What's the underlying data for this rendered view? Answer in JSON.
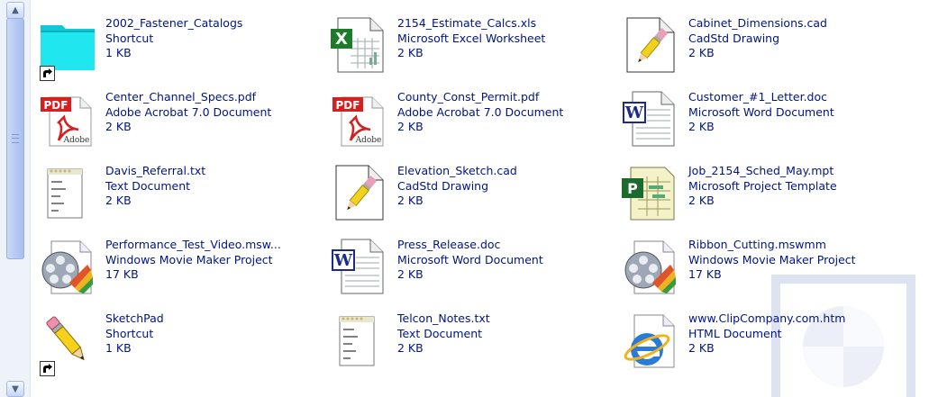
{
  "files": [
    {
      "name": "2002_Fastener_Catalogs",
      "type": "Shortcut",
      "size": "1 KB",
      "icon": "folder-shortcut-icon"
    },
    {
      "name": "2154_Estimate_Calcs.xls",
      "type": "Microsoft Excel Worksheet",
      "size": "2 KB",
      "icon": "excel-icon"
    },
    {
      "name": "Cabinet_Dimensions.cad",
      "type": "CadStd Drawing",
      "size": "2 KB",
      "icon": "cad-pencil-icon"
    },
    {
      "name": "Center_Channel_Specs.pdf",
      "type": "Adobe Acrobat 7.0 Document",
      "size": "2 KB",
      "icon": "pdf-icon"
    },
    {
      "name": "County_Const_Permit.pdf",
      "type": "Adobe Acrobat 7.0 Document",
      "size": "2 KB",
      "icon": "pdf-icon"
    },
    {
      "name": "Customer_#1_Letter.doc",
      "type": "Microsoft Word Document",
      "size": "2 KB",
      "icon": "word-icon"
    },
    {
      "name": "Davis_Referral.txt",
      "type": "Text Document",
      "size": "2 KB",
      "icon": "text-document-icon"
    },
    {
      "name": "Elevation_Sketch.cad",
      "type": "CadStd Drawing",
      "size": "2 KB",
      "icon": "cad-pencil-icon"
    },
    {
      "name": "Job_2154_Sched_May.mpt",
      "type": "Microsoft Project Template",
      "size": "2 KB",
      "icon": "project-icon"
    },
    {
      "name": "Performance_Test_Video.msw...",
      "type": "Windows Movie Maker Project",
      "size": "17 KB",
      "icon": "movie-maker-icon"
    },
    {
      "name": "Press_Release.doc",
      "type": "Microsoft Word Document",
      "size": "2 KB",
      "icon": "word-icon"
    },
    {
      "name": "Ribbon_Cutting.mswmm",
      "type": "Windows Movie Maker Project",
      "size": "17 KB",
      "icon": "movie-maker-icon"
    },
    {
      "name": "SketchPad",
      "type": "Shortcut",
      "size": "1 KB",
      "icon": "pencil-shortcut-icon"
    },
    {
      "name": "Telcon_Notes.txt",
      "type": "Text Document",
      "size": "2 KB",
      "icon": "text-document-icon"
    },
    {
      "name": "www.ClipCompany.com.htm",
      "type": "HTML Document",
      "size": "2 KB",
      "icon": "internet-explorer-icon"
    }
  ]
}
